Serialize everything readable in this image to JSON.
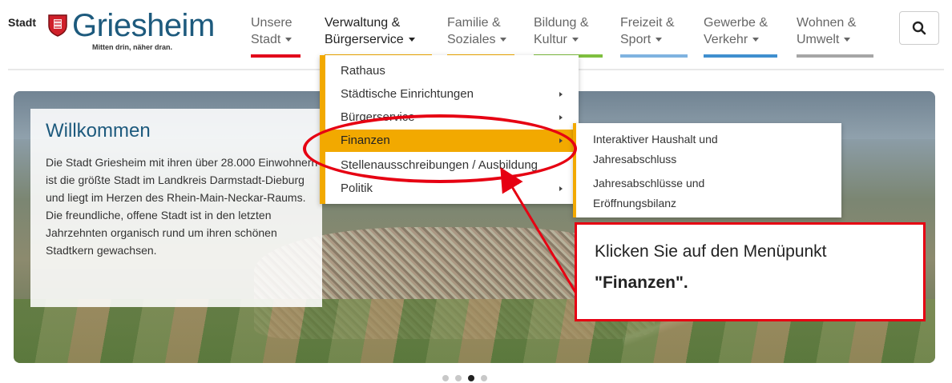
{
  "logo": {
    "prefix": "Stadt",
    "name": "Griesheim",
    "tagline": "Mitten drin, näher dran."
  },
  "nav": [
    {
      "line1": "Unsere",
      "line2": "Stadt",
      "color": "#e2001a",
      "active": false
    },
    {
      "line1": "Verwaltung &",
      "line2": "Bürgerservice",
      "color": "#f2a900",
      "active": true
    },
    {
      "line1": "Familie &",
      "line2": "Soziales",
      "color": "#f2a900",
      "active": false
    },
    {
      "line1": "Bildung &",
      "line2": "Kultur",
      "color": "#7fbf3f",
      "active": false
    },
    {
      "line1": "Freizeit &",
      "line2": "Sport",
      "color": "#7fb3e0",
      "active": false
    },
    {
      "line1": "Gewerbe &",
      "line2": "Verkehr",
      "color": "#3f8fcf",
      "active": false
    },
    {
      "line1": "Wohnen &",
      "line2": "Umwelt",
      "color": "#a6a6a6",
      "active": false
    }
  ],
  "search": {
    "icon": "search-icon"
  },
  "dropdown": [
    {
      "label": "Rathaus",
      "has_submenu": false,
      "active": false
    },
    {
      "label": "Städtische Einrichtungen",
      "has_submenu": true,
      "active": false
    },
    {
      "label": "Bürgerservice",
      "has_submenu": true,
      "active": false
    },
    {
      "label": "Finanzen",
      "has_submenu": true,
      "active": true
    },
    {
      "label": "Stellenausschreibungen / Ausbildung",
      "has_submenu": false,
      "active": false
    },
    {
      "label": "Politik",
      "has_submenu": true,
      "active": false
    }
  ],
  "submenu": [
    {
      "line1": "Interaktiver Haushalt und",
      "line2": "Jahresabschluss"
    },
    {
      "line1": "Jahresabschlüsse und",
      "line2": "Eröffnungsbilanz"
    }
  ],
  "welcome": {
    "title": "Willkommen",
    "text": "Die Stadt Griesheim mit ihren über 28.000 Einwohnern ist die größte Stadt im Landkreis Darmstadt-Dieburg und liegt im Herzen des Rhein-Main-Neckar-Raums. Die freundliche, offene Stadt ist in den letzten Jahrzehnten organisch rund um ihren schönen Stadtkern gewachsen."
  },
  "callout": {
    "text1": "Klicken Sie auf den Menüpunkt",
    "text2": "\"Finanzen\"."
  },
  "colors": {
    "accent": "#f2a900",
    "annotation": "#e60012",
    "brand": "#1d5a7d"
  },
  "carousel": {
    "count": 4,
    "active_index": 2
  }
}
